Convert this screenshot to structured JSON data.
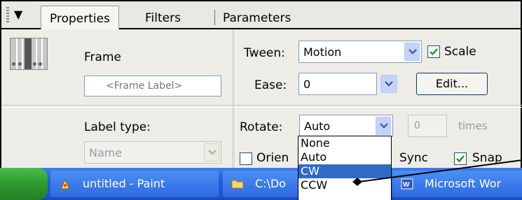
{
  "tabs": {
    "active": "Properties",
    "filters": "Filters",
    "parameters": "Parameters"
  },
  "frame": {
    "title": "Frame",
    "label_placeholder": "<Frame Label>"
  },
  "label_type": {
    "label": "Label type:",
    "value": "Name"
  },
  "tween": {
    "label": "Tween:",
    "value": "Motion",
    "scale_label": "Scale",
    "scale_checked": true
  },
  "ease": {
    "label": "Ease:",
    "value": "0",
    "edit_button": "Edit..."
  },
  "rotate": {
    "label": "Rotate:",
    "value": "Auto",
    "times_value": "0",
    "times_label": "times",
    "options": [
      "None",
      "Auto",
      "CW",
      "CCW"
    ],
    "selected_option": "CW"
  },
  "checkboxes": {
    "orient_label": "Orien",
    "sync_label": "Sync",
    "snap_label": "Snap",
    "snap_checked": true
  },
  "taskbar": {
    "paint": "untitled - Paint",
    "folder": "C:\\Do",
    "word": "Microsoft Wor"
  },
  "colors": {
    "selection": "#316ac5",
    "taskbar": "#245edb",
    "start": "#2e9a2e"
  }
}
